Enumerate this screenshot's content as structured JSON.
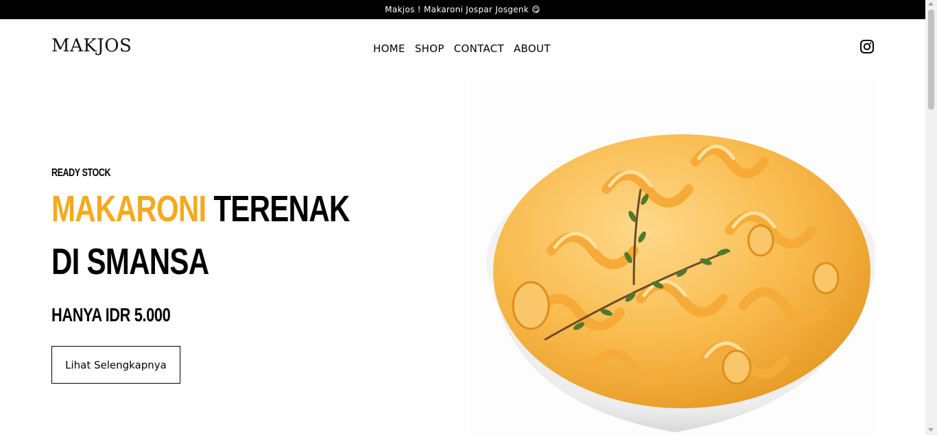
{
  "announcement": {
    "text": "Makjos ! Makaroni Jospar Josgenk 😋"
  },
  "header": {
    "logo": "MAKJOS",
    "nav": [
      "HOME",
      "SHOP",
      "CONTACT",
      "ABOUT"
    ],
    "social_icon": "instagram-icon"
  },
  "hero": {
    "eyebrow": "READY STOCK",
    "headline_accent": "MAKARONI",
    "headline_rest": "TERENAK",
    "headline_line2": "DI SMANSA",
    "price": "HANYA IDR 5.000",
    "cta_label": "Lihat Selengkapnya",
    "image": "bowl of macaroni with thyme",
    "accent_color": "#f5a91e"
  }
}
